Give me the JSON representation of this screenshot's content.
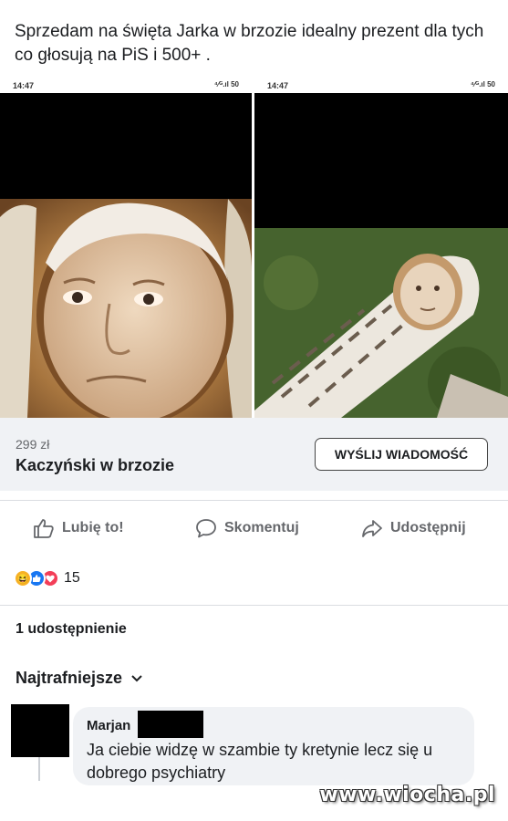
{
  "post": {
    "text": "Sprzedam na święta Jarka w brzozie idealny prezent dla tych co głosują na PiS i 500+ ."
  },
  "screenshots": [
    {
      "time": "14:47",
      "indicators": "⁴⁄ᴳ.ıl 50"
    },
    {
      "time": "14:47",
      "indicators": "⁴⁄ᴳ.ıl 50"
    }
  ],
  "listing": {
    "price": "299 zł",
    "title": "Kaczyński w brzozie",
    "message_button": "WYŚLIJ WIADOMOŚĆ"
  },
  "actions": {
    "like": "Lubię to!",
    "comment": "Skomentuj",
    "share": "Udostępnij"
  },
  "reactions": {
    "count": "15",
    "icons": [
      "haha-icon",
      "like-icon",
      "love-icon"
    ]
  },
  "shares": "1 udostępnienie",
  "comments": {
    "sort_label": "Najtrafniejsze",
    "items": [
      {
        "author": "Marjan",
        "text": "Ja ciebie widzę w szambie ty kretynie lecz się u dobrego psychiatry"
      }
    ]
  },
  "watermark": "www.wiocha.pl",
  "colors": {
    "accent": "#1877f2",
    "love": "#f33e58",
    "haha": "#f7b125",
    "secondary_text": "#65676b",
    "panel": "#f0f2f5"
  }
}
